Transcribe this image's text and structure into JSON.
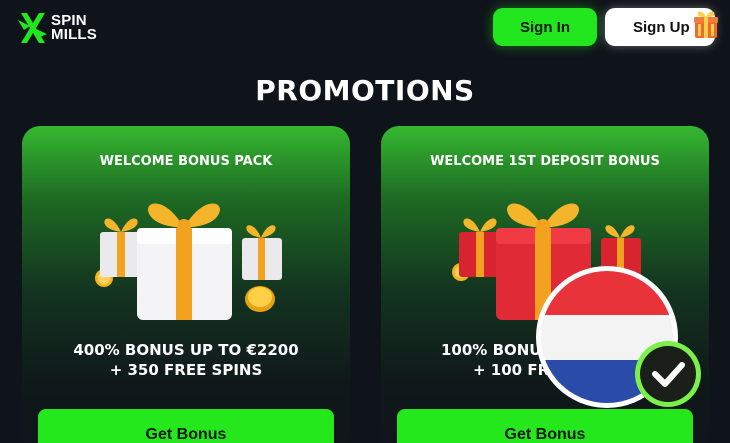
{
  "header": {
    "logo_line1": "SPIN",
    "logo_line2": "MILLS",
    "sign_in_label": "Sign In",
    "sign_up_label": "Sign Up",
    "icons": [
      "x-logo-icon",
      "gift-icon"
    ]
  },
  "page": {
    "title": "PROMOTIONS"
  },
  "promotions": [
    {
      "title": "WELCOME BONUS PACK",
      "line1": "400% BONUS UP TO €2200",
      "line2": "+ 350 FREE SPINS",
      "button": "Get Bonus",
      "gift_color": "white"
    },
    {
      "title": "WELCOME 1ST DEPOSIT BONUS",
      "line1": "100% BONU",
      "line2": "+ 100 FR",
      "button": "Get Bonus",
      "gift_color": "red"
    }
  ],
  "badge": {
    "icons": [
      "netherlands-flag-icon",
      "check-circle-icon"
    ]
  },
  "colors": {
    "accent_green": "#25e81c",
    "background": "#0f131a",
    "flag_red": "#e8333a",
    "flag_blue": "#2b4ba8"
  }
}
